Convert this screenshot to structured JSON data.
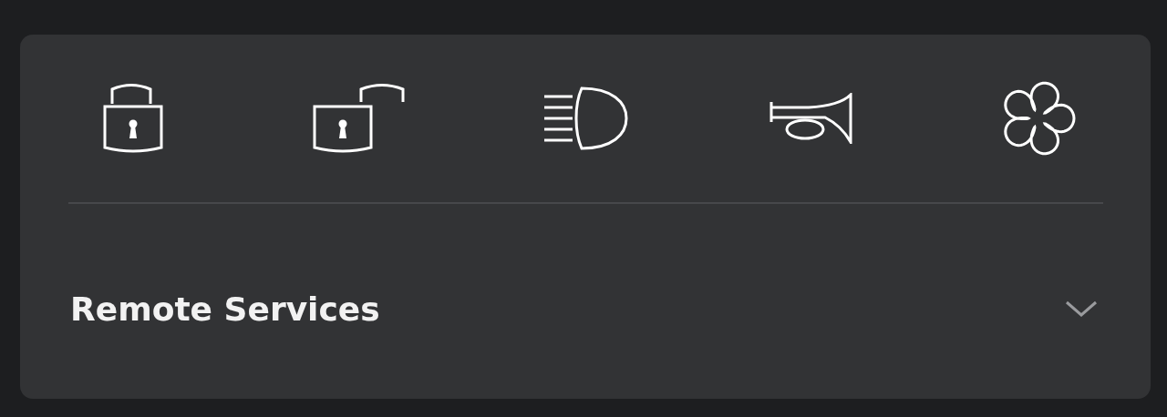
{
  "actions": [
    {
      "kind": "lock"
    },
    {
      "kind": "unlock"
    },
    {
      "kind": "lights"
    },
    {
      "kind": "horn"
    },
    {
      "kind": "fan"
    }
  ],
  "section": {
    "title": "Remote Services",
    "expanded": false
  }
}
